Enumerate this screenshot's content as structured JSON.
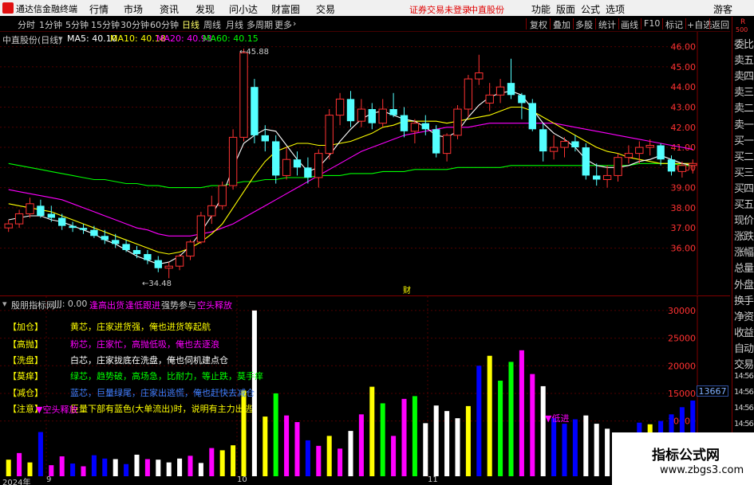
{
  "app": {
    "title": "通达信金融终端",
    "menu": [
      "行情",
      "市场",
      "资讯",
      "发现",
      "问小达",
      "财富圈",
      "交易"
    ],
    "notice": "证券交易未登录",
    "stock_name_top": "中直股份",
    "right_menu": [
      "功能",
      "版面",
      "公式",
      "选项",
      "游客"
    ]
  },
  "toolbar": {
    "periods": [
      "分时",
      "1分钟",
      "5分钟",
      "15分钟",
      "30分钟",
      "60分钟",
      "日线",
      "周线",
      "月线",
      "多周期",
      "更多"
    ],
    "active_period": "日线",
    "right_buttons": [
      "复权",
      "叠加",
      "多股",
      "统计",
      "画线",
      "F10",
      "标记",
      "+自选",
      "返回"
    ]
  },
  "main_chart": {
    "stock_label": "中直股份(日线)",
    "ma5_label": "MA5: 40.10",
    "ma10_label": "MA10: 40.18",
    "ma20_label": "MA20: 40.93",
    "ma60_label": "MA60: 40.15",
    "high_mark": "45.88",
    "low_mark": "34.48",
    "event_mark": "财",
    "y_ticks": [
      "46.00",
      "45.00",
      "44.00",
      "43.00",
      "42.00",
      "41.00",
      "40.00",
      "39.00",
      "38.00",
      "37.00",
      "36.00"
    ]
  },
  "indicator": {
    "name": "殷朋指标网",
    "jjj": "JJJ: 0.00",
    "tags": [
      "逢高出货",
      "逢低跟进",
      "强势参与",
      "空头释放"
    ],
    "legend": [
      {
        "tag": "【加仓】",
        "text": "黄芯，庄家进货强，俺也进货等起航",
        "color": "#ffff00"
      },
      {
        "tag": "【高抛】",
        "text": "粉芯，庄家忙，高抛低吸，俺也去逐浪",
        "color": "#ff00ff"
      },
      {
        "tag": "【洗盘】",
        "text": "白芯，庄家拢底在洗盘，俺也伺机建点仓",
        "color": "#ffffff"
      },
      {
        "tag": "【莫痒】",
        "text": "绿芯，趋势破，高场急，比耐力，等止跌，莫手痒",
        "color": "#00ff00"
      },
      {
        "tag": "【减仓】",
        "text": "蓝芯，巨量绿尾，庄家出逃慌，俺也赶快去减仓",
        "color": "#4060ff"
      },
      {
        "tag": "【注意】",
        "text": "巨量下部有蓝色(大单流出)时，说明有主力出逃",
        "color": "#ffff00"
      }
    ],
    "sell_mark": "空头释放",
    "buy_mark": "低进",
    "current_value": "13667",
    "y_ticks": [
      "30000",
      "25000",
      "20000",
      "15000",
      "10000"
    ]
  },
  "time_axis": {
    "labels": [
      "2024年",
      "9",
      "10",
      "11"
    ]
  },
  "quote_panel": {
    "items": [
      "委比",
      "卖五",
      "卖四",
      "卖三",
      "卖二",
      "卖一",
      "买一",
      "买二",
      "买三",
      "买四",
      "买五",
      "现价",
      "涨跌",
      "涨幅",
      "总量",
      "外盘",
      "换手",
      "净资",
      "收益",
      "自动",
      "交易",
      "14:56",
      "14:56",
      "14:56",
      "14:56",
      "14:56",
      "14:56",
      "14:56",
      "14:56"
    ],
    "rs_label": "R",
    "rs_value": "500"
  },
  "watermark": {
    "title": "指标公式网",
    "url": "www.zbgs3.com"
  },
  "colors": {
    "up": "#ff3232",
    "down": "#54ffff",
    "ma5": "#ffffff",
    "ma10": "#ffff00",
    "ma20": "#ff00ff",
    "ma60": "#00ff00"
  },
  "chart_data": [
    {
      "type": "candlestick",
      "title": "中直股份(日线)",
      "ylim": [
        34.0,
        46.5
      ],
      "candles": [
        [
          37.0,
          37.4,
          36.8,
          37.2
        ],
        [
          37.2,
          37.9,
          37.0,
          37.7
        ],
        [
          37.7,
          38.5,
          37.5,
          38.2
        ],
        [
          38.1,
          38.4,
          37.5,
          37.6
        ],
        [
          37.7,
          38.1,
          37.3,
          37.5
        ],
        [
          37.5,
          37.7,
          36.9,
          37.1
        ],
        [
          37.1,
          37.3,
          36.8,
          37.0
        ],
        [
          37.0,
          37.2,
          36.7,
          36.9
        ],
        [
          36.9,
          37.1,
          36.5,
          36.6
        ],
        [
          36.6,
          36.9,
          36.2,
          36.4
        ],
        [
          36.4,
          36.7,
          36.0,
          36.2
        ],
        [
          36.2,
          36.4,
          35.8,
          35.9
        ],
        [
          35.9,
          36.1,
          35.5,
          35.7
        ],
        [
          35.7,
          35.9,
          35.2,
          35.4
        ],
        [
          35.4,
          35.6,
          34.8,
          35.0
        ],
        [
          35.0,
          35.3,
          34.5,
          35.1
        ],
        [
          35.1,
          35.7,
          34.9,
          35.6
        ],
        [
          35.6,
          36.4,
          35.4,
          36.3
        ],
        [
          36.3,
          37.8,
          36.2,
          37.6
        ],
        [
          37.6,
          38.6,
          37.2,
          38.1
        ],
        [
          38.1,
          39.3,
          37.9,
          39.1
        ],
        [
          39.1,
          41.9,
          38.9,
          41.5
        ],
        [
          41.5,
          45.9,
          41.3,
          45.7
        ],
        [
          44.0,
          44.4,
          41.2,
          41.6
        ],
        [
          41.6,
          42.1,
          40.8,
          41.3
        ],
        [
          41.3,
          41.6,
          39.2,
          39.6
        ],
        [
          39.6,
          41.0,
          39.4,
          40.4
        ],
        [
          40.4,
          40.8,
          39.6,
          40.0
        ],
        [
          40.0,
          40.5,
          39.2,
          39.5
        ],
        [
          39.5,
          40.9,
          39.0,
          40.7
        ],
        [
          40.7,
          42.9,
          40.4,
          42.6
        ],
        [
          42.6,
          43.7,
          42.1,
          43.4
        ],
        [
          43.4,
          43.8,
          42.0,
          42.3
        ],
        [
          42.3,
          43.4,
          42.0,
          42.9
        ],
        [
          42.9,
          43.2,
          41.9,
          42.2
        ],
        [
          42.2,
          43.4,
          42.0,
          42.9
        ],
        [
          42.9,
          43.7,
          42.5,
          42.6
        ],
        [
          42.6,
          43.0,
          41.5,
          41.8
        ],
        [
          41.8,
          42.4,
          41.2,
          42.2
        ],
        [
          42.2,
          42.6,
          41.6,
          41.9
        ],
        [
          41.9,
          42.1,
          40.5,
          40.7
        ],
        [
          40.7,
          41.7,
          40.3,
          41.6
        ],
        [
          41.6,
          43.1,
          41.4,
          42.9
        ],
        [
          42.9,
          44.6,
          42.5,
          44.4
        ],
        [
          44.4,
          45.6,
          44.1,
          44.7
        ],
        [
          43.2,
          44.2,
          42.8,
          43.6
        ],
        [
          43.6,
          44.4,
          43.2,
          44.0
        ],
        [
          44.2,
          45.4,
          43.4,
          43.6
        ],
        [
          43.6,
          43.7,
          42.4,
          43.2
        ],
        [
          43.2,
          43.4,
          41.8,
          41.9
        ],
        [
          41.9,
          42.2,
          40.3,
          40.8
        ],
        [
          40.8,
          41.6,
          40.4,
          41.0
        ],
        [
          41.0,
          41.5,
          40.5,
          41.3
        ],
        [
          41.3,
          41.6,
          40.8,
          41.0
        ],
        [
          41.0,
          41.2,
          39.4,
          39.6
        ],
        [
          39.6,
          40.2,
          39.1,
          39.4
        ],
        [
          39.4,
          40.1,
          39.0,
          39.6
        ],
        [
          39.6,
          40.7,
          39.3,
          40.5
        ],
        [
          40.5,
          41.1,
          40.2,
          40.7
        ],
        [
          40.7,
          41.3,
          40.2,
          41.0
        ],
        [
          41.0,
          41.4,
          40.6,
          41.1
        ],
        [
          41.1,
          41.2,
          40.1,
          40.4
        ],
        [
          40.4,
          40.6,
          39.6,
          39.8
        ],
        [
          39.8,
          40.3,
          39.5,
          40.1
        ],
        [
          40.1,
          40.4,
          39.7,
          40.2
        ]
      ],
      "ma5": [
        37.4,
        37.5,
        37.6,
        37.6,
        37.4,
        37.3,
        37.1,
        36.9,
        36.7,
        36.4,
        36.2,
        35.9,
        35.6,
        35.4,
        35.2,
        35.3,
        35.6,
        36.1,
        36.8,
        37.6,
        38.6,
        40.0,
        41.2,
        41.6,
        41.9,
        41.8,
        41.1,
        40.4,
        39.8,
        40.0,
        40.6,
        41.3,
        41.9,
        42.4,
        42.7,
        42.8,
        42.6,
        42.4,
        42.3,
        42.0,
        41.6,
        41.5,
        41.8,
        42.5,
        43.1,
        43.5,
        43.7,
        43.8,
        43.6,
        42.9,
        42.2,
        41.7,
        41.4,
        41.0,
        40.4,
        40.1,
        40.0,
        40.0,
        40.1,
        40.3,
        40.4,
        40.6,
        40.4,
        40.2,
        40.1
      ],
      "ma10": [
        38.2,
        38.1,
        38.0,
        37.9,
        37.8,
        37.6,
        37.4,
        37.2,
        37.0,
        36.8,
        36.6,
        36.4,
        36.2,
        36.0,
        35.8,
        35.7,
        35.8,
        36.0,
        36.3,
        36.7,
        37.2,
        38.0,
        38.8,
        39.6,
        40.3,
        40.8,
        41.0,
        41.2,
        41.2,
        41.1,
        41.1,
        41.2,
        41.3,
        41.5,
        41.7,
        42.0,
        42.1,
        42.3,
        42.3,
        42.3,
        42.3,
        42.2,
        42.3,
        42.4,
        42.5,
        42.6,
        42.8,
        43.0,
        43.0,
        42.8,
        42.5,
        42.2,
        41.9,
        41.6,
        41.3,
        41.0,
        40.8,
        40.7,
        40.5,
        40.4,
        40.3,
        40.2,
        40.2,
        40.2,
        40.2
      ],
      "ma20": [
        38.9,
        38.8,
        38.7,
        38.6,
        38.5,
        38.4,
        38.2,
        38.0,
        37.8,
        37.6,
        37.4,
        37.2,
        37.0,
        36.9,
        36.7,
        36.6,
        36.6,
        36.6,
        36.7,
        36.8,
        37.0,
        37.2,
        37.5,
        37.8,
        38.1,
        38.4,
        38.7,
        39.0,
        39.3,
        39.6,
        39.9,
        40.2,
        40.5,
        40.8,
        41.0,
        41.2,
        41.4,
        41.6,
        41.7,
        41.8,
        41.9,
        42.0,
        42.0,
        42.0,
        42.1,
        42.2,
        42.2,
        42.2,
        42.2,
        42.2,
        42.2,
        42.2,
        42.1,
        42.0,
        41.9,
        41.8,
        41.7,
        41.6,
        41.5,
        41.4,
        41.3,
        41.2,
        41.1,
        41.0,
        40.9
      ],
      "ma60": [
        40.2,
        40.1,
        40.0,
        39.9,
        39.8,
        39.7,
        39.6,
        39.5,
        39.4,
        39.4,
        39.3,
        39.2,
        39.2,
        39.1,
        39.1,
        39.0,
        39.0,
        39.0,
        39.0,
        39.1,
        39.1,
        39.2,
        39.3,
        39.3,
        39.4,
        39.4,
        39.5,
        39.5,
        39.5,
        39.6,
        39.6,
        39.6,
        39.7,
        39.7,
        39.7,
        39.8,
        39.8,
        39.8,
        39.9,
        39.9,
        39.9,
        39.9,
        40.0,
        40.0,
        40.0,
        40.0,
        40.0,
        40.1,
        40.1,
        40.1,
        40.1,
        40.1,
        40.1,
        40.1,
        40.1,
        40.1,
        40.1,
        40.1,
        40.1,
        40.2,
        40.2,
        40.2,
        40.2,
        40.1,
        40.1
      ]
    },
    {
      "type": "bar",
      "title": "殷朋指标网",
      "ylim": [
        0,
        32000
      ],
      "values": [
        3000,
        4200,
        2500,
        8000,
        2000,
        3600,
        2300,
        1800,
        3800,
        3200,
        3100,
        2200,
        3900,
        3100,
        3000,
        2500,
        3200,
        3700,
        2400,
        5100,
        4700,
        5600,
        15500,
        30000,
        10800,
        15000,
        11000,
        9800,
        6500,
        5500,
        7300,
        5000,
        8200,
        11200,
        16200,
        13200,
        7300,
        14000,
        14500,
        9600,
        12800,
        11800,
        10500,
        12700,
        20000,
        21800,
        17300,
        20700,
        22800,
        18500,
        16300,
        10500,
        9500,
        10300,
        11000,
        9500,
        8600,
        7800,
        6500,
        9700,
        9400,
        10000,
        11200,
        12500,
        13700
      ],
      "colors": [
        "#ffff00",
        "#ff00ff",
        "#ffff00",
        "#0000ff",
        "#ff00ff",
        "#ff00ff",
        "#0000ff",
        "#ff00ff",
        "#0000ff",
        "#0000ff",
        "#ffffff",
        "#0000ff",
        "#ffffff",
        "#ff00ff",
        "#ffffff",
        "#ffffff",
        "#ffffff",
        "#ff00ff",
        "#ffffff",
        "#ff00ff",
        "#ffff00",
        "#ffff00",
        "#ffff00",
        "#ffffff",
        "#ffff00",
        "#00ff00",
        "#ff00ff",
        "#ff00ff",
        "#0000ff",
        "#ff00ff",
        "#ffff00",
        "#ff00ff",
        "#ffffff",
        "#ff00ff",
        "#ffff00",
        "#00ff00",
        "#ff00ff",
        "#ff00ff",
        "#00ff00",
        "#ffffff",
        "#ffffff",
        "#ffffff",
        "#ffffff",
        "#ffff00",
        "#0000ff",
        "#ffff00",
        "#00ff00",
        "#00ff00",
        "#ff00ff",
        "#ff00ff",
        "#ffffff",
        "#0000ff",
        "#0000ff",
        "#0000ff",
        "#ffffff",
        "#ffffff",
        "#ffffff",
        "#ffffff",
        "#ffffff",
        "#0000ff",
        "#ffff00",
        "#0000ff",
        "#0000ff",
        "#0000ff",
        "#0000ff"
      ]
    }
  ]
}
